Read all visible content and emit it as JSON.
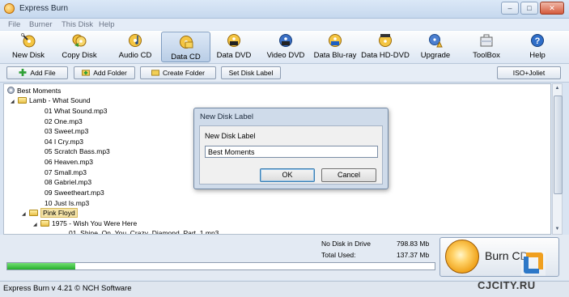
{
  "window": {
    "title": "Express Burn",
    "controls": [
      "–",
      "□",
      "✕"
    ]
  },
  "menu": [
    "File",
    "Burner",
    "This Disk",
    "Help"
  ],
  "toolbar": [
    {
      "label": "New Disk",
      "icon": "wand-disc-icon"
    },
    {
      "label": "Copy Disk",
      "icon": "copy-disc-icon"
    },
    {
      "label": "Audio CD",
      "icon": "audio-cd-icon"
    },
    {
      "label": "Data CD",
      "icon": "data-cd-icon",
      "active": true
    },
    {
      "label": "Data DVD",
      "icon": "dvd-icon"
    },
    {
      "label": "Video DVD",
      "icon": "video-dvd-icon"
    },
    {
      "label": "Data Blu-ray",
      "icon": "bluray-icon"
    },
    {
      "label": "Data HD-DVD",
      "icon": "hddvd-icon"
    },
    {
      "label": "Upgrade",
      "icon": "upgrade-icon"
    },
    {
      "label": "ToolBox",
      "icon": "toolbox-icon"
    },
    {
      "label": "Help",
      "icon": "help-icon"
    }
  ],
  "actions": {
    "add_file": "Add File",
    "add_folder": "Add Folder",
    "create_folder": "Create Folder",
    "set_disk_label": "Set Disk Label",
    "iso_joliet": "ISO+Joliet"
  },
  "tree": {
    "root": "Best Moments",
    "album1": "Lamb - What Sound",
    "tracks": [
      "01 What Sound.mp3",
      "02 One.mp3",
      "03 Sweet.mp3",
      "04 I Cry.mp3",
      "05 Scratch Bass.mp3",
      "06 Heaven.mp3",
      "07 Small.mp3",
      "08 Gabriel.mp3",
      "09 Sweetheart.mp3",
      "10 Just Is.mp3"
    ],
    "artist2": "Pink Floyd",
    "album2": "1975 - Wish You Were Here",
    "track2": "01_Shine_On_You_Crazy_Diamond_Part_1.mp3"
  },
  "status": {
    "drive_label": "No Disk in Drive",
    "drive_value": "798.83 Mb",
    "total_label": "Total Used:",
    "total_value": "137.37 Mb",
    "progress_fraction": 0.16
  },
  "burn_button": "Burn CD",
  "statusbar": "Express Burn v 4.21 © NCH Software",
  "watermark": "CJCITY.RU",
  "dialog": {
    "title": "New Disk Label",
    "prompt": "New Disk Label",
    "value": "Best Moments",
    "ok": "OK",
    "cancel": "Cancel"
  }
}
